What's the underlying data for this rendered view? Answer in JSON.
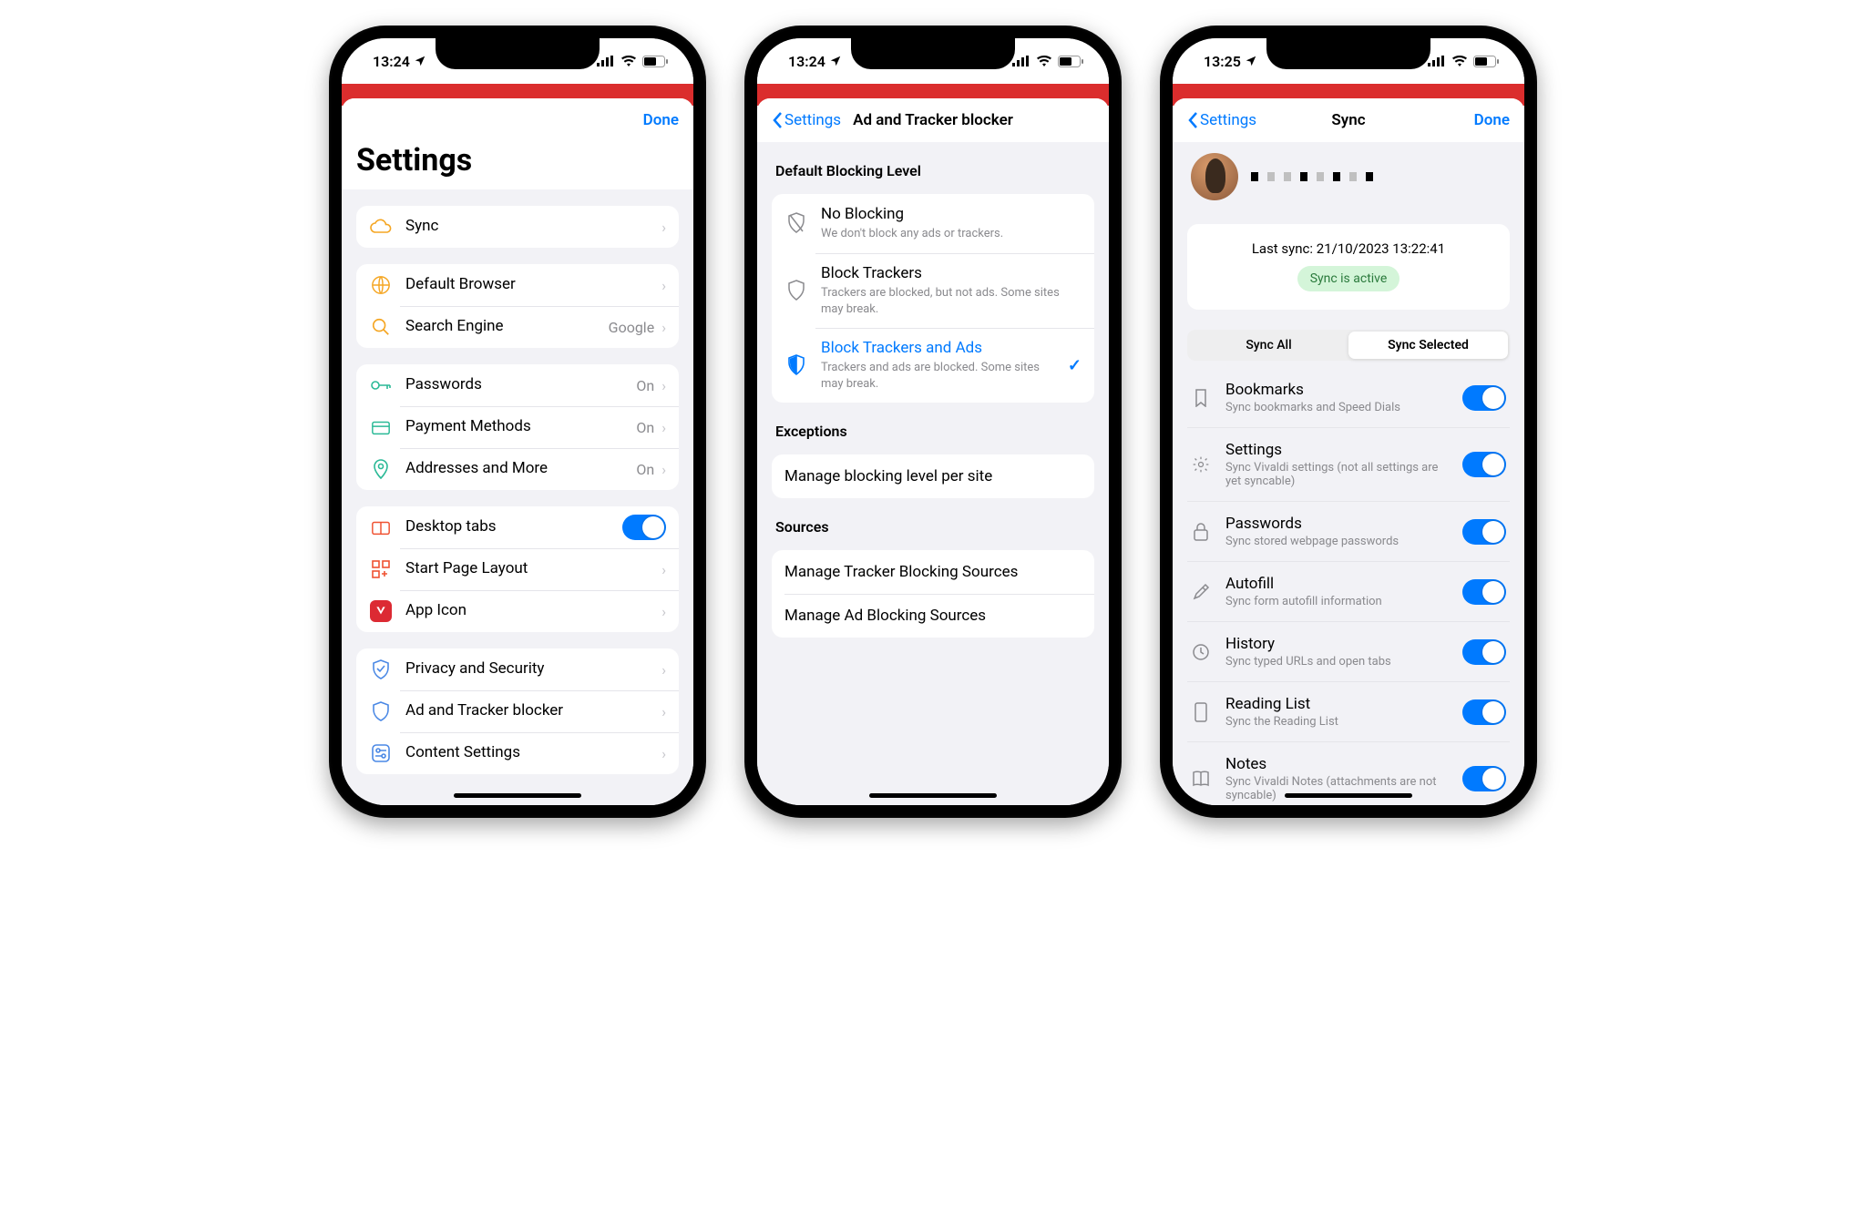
{
  "phone1": {
    "time": "13:24",
    "done": "Done",
    "title": "Settings",
    "settings": [
      {
        "label": "Sync"
      },
      {
        "label": "Default Browser"
      },
      {
        "label": "Search Engine",
        "detail": "Google"
      },
      {
        "label": "Passwords",
        "detail": "On"
      },
      {
        "label": "Payment Methods",
        "detail": "On"
      },
      {
        "label": "Addresses and More",
        "detail": "On"
      },
      {
        "label": "Desktop tabs"
      },
      {
        "label": "Start Page Layout"
      },
      {
        "label": "App Icon"
      },
      {
        "label": "Privacy and Security"
      },
      {
        "label": "Ad and Tracker blocker"
      },
      {
        "label": "Content Settings"
      }
    ]
  },
  "phone2": {
    "time": "13:24",
    "back": "Settings",
    "title": "Ad and Tracker blocker",
    "sectionBlocking": "Default Blocking Level",
    "sectionExceptions": "Exceptions",
    "sectionSources": "Sources",
    "levels": [
      {
        "t": "No Blocking",
        "s": "We don't block any ads or trackers."
      },
      {
        "t": "Block Trackers",
        "s": "Trackers are blocked, but not ads. Some sites may break."
      },
      {
        "t": "Block Trackers and Ads",
        "s": "Trackers and ads are blocked. Some sites may break."
      }
    ],
    "exceptions": "Manage blocking level per site",
    "srcTrackers": "Manage Tracker Blocking Sources",
    "srcAds": "Manage Ad Blocking Sources"
  },
  "phone3": {
    "time": "13:25",
    "back": "Settings",
    "title": "Sync",
    "done": "Done",
    "lastSync": "Last sync: 21/10/2023 13:22:41",
    "syncActive": "Sync is active",
    "segAll": "Sync All",
    "segSelected": "Sync Selected",
    "items": [
      {
        "t": "Bookmarks",
        "s": "Sync bookmarks and Speed Dials"
      },
      {
        "t": "Settings",
        "s": "Sync Vivaldi settings (not all settings are yet syncable)"
      },
      {
        "t": "Passwords",
        "s": "Sync stored webpage passwords"
      },
      {
        "t": "Autofill",
        "s": "Sync form autofill information"
      },
      {
        "t": "History",
        "s": "Sync typed URLs and open tabs"
      },
      {
        "t": "Reading List",
        "s": "Sync the Reading List"
      },
      {
        "t": "Notes",
        "s": "Sync Vivaldi Notes (attachments are not syncable)"
      }
    ]
  }
}
